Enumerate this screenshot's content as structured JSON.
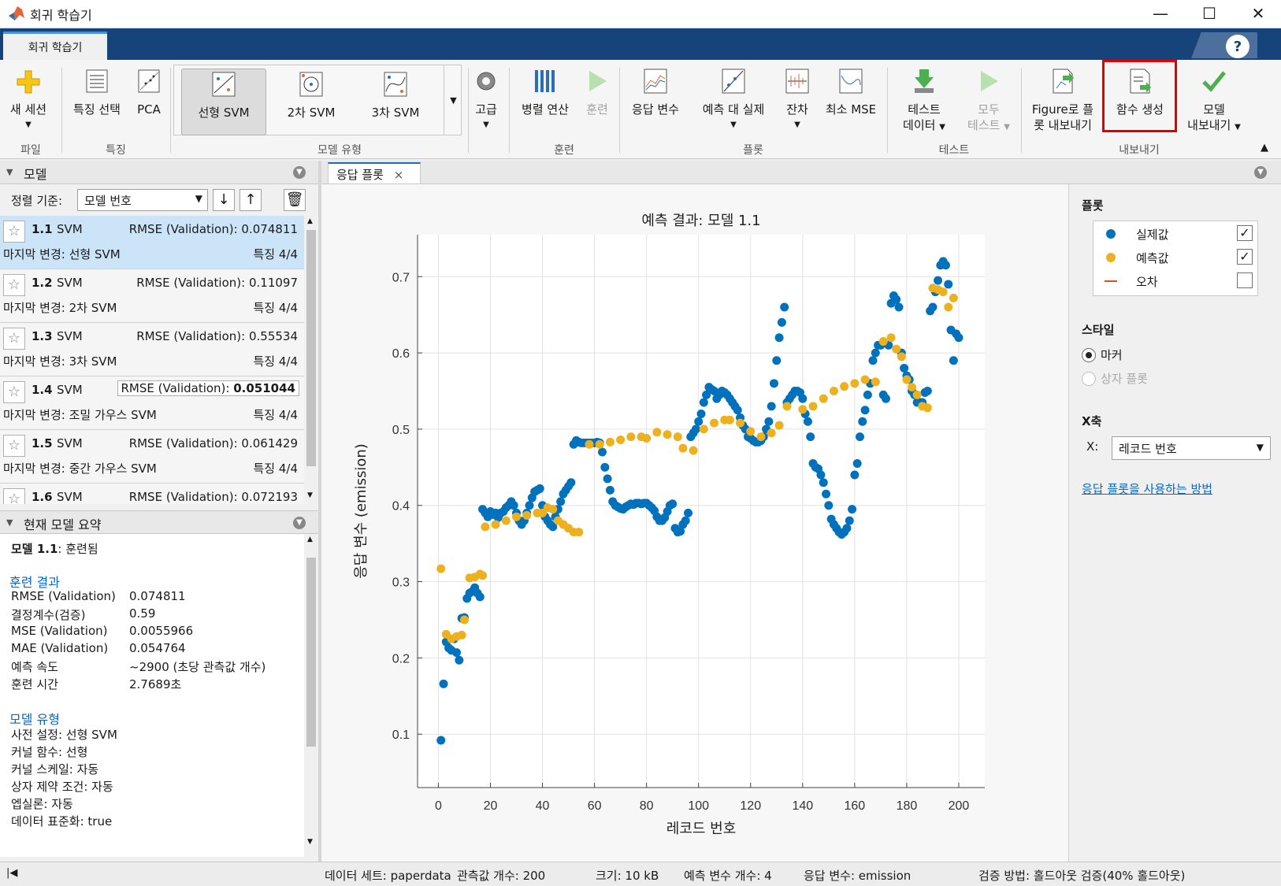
{
  "window": {
    "title": "회귀 학습기"
  },
  "tabs": {
    "main": "회귀 학습기",
    "help": "?"
  },
  "ribbon": {
    "new_session": "새 세션",
    "feature_select": "특징 선택",
    "pca": "PCA",
    "gallery": [
      "선형 SVM",
      "2차 SVM",
      "3차 SVM"
    ],
    "advanced": "고급",
    "parallel": "병렬 연산",
    "train": "훈련",
    "response": "응답 변수",
    "pred_vs_actual": "예측 대 실제",
    "residuals": "잔차",
    "min_mse": "최소 MSE",
    "test_data_1": "테스트",
    "test_data_2": "데이터",
    "test_all_1": "모두",
    "test_all_2": "테스트",
    "export_fig_1": "Figure로 플",
    "export_fig_2": "롯 내보내기",
    "gen_func": "함수 생성",
    "export_model_1": "모델",
    "export_model_2": "내보내기",
    "groups": {
      "file": "파일",
      "features": "특징",
      "model_type": "모델 유형",
      "training": "훈련",
      "plots": "플롯",
      "test": "테스트",
      "export": "내보내기"
    }
  },
  "models_panel": {
    "title": "모델",
    "sort_label": "정렬 기준:",
    "sort_value": "모델 번호",
    "items": [
      {
        "id": "1.1",
        "type": "SVM",
        "rmse": "RMSE (Validation): 0.074811",
        "last": "마지막 변경: 선형 SVM",
        "feat": "특징 4/4"
      },
      {
        "id": "1.2",
        "type": "SVM",
        "rmse": "RMSE (Validation): 0.11097",
        "last": "마지막 변경: 2차 SVM",
        "feat": "특징 4/4"
      },
      {
        "id": "1.3",
        "type": "SVM",
        "rmse": "RMSE (Validation): 0.55534",
        "last": "마지막 변경: 3차 SVM",
        "feat": "특징 4/4"
      },
      {
        "id": "1.4",
        "type": "SVM",
        "rmse_label": "RMSE (Validation): ",
        "rmse_val": "0.051044",
        "last": "마지막 변경: 조밀 가우스 SVM",
        "feat": "특징 4/4"
      },
      {
        "id": "1.5",
        "type": "SVM",
        "rmse": "RMSE (Validation): 0.061429",
        "last": "마지막 변경: 중간 가우스 SVM",
        "feat": "특징 4/4"
      },
      {
        "id": "1.6",
        "type": "SVM",
        "rmse": "RMSE (Validation): 0.072193",
        "last": "",
        "feat": ""
      }
    ]
  },
  "summary": {
    "title": "현재 모델 요약",
    "model_line_bold": "모델 1.1",
    "model_line_rest": ": 훈련됨",
    "results_hdr": "훈련 결과",
    "results": [
      [
        "RMSE (Validation)",
        "0.074811"
      ],
      [
        "결정계수(검증)",
        "0.59"
      ],
      [
        "MSE (Validation)",
        "0.0055966"
      ],
      [
        "MAE (Validation)",
        "0.054764"
      ],
      [
        "예측 속도",
        "~2900 (초당 관측값 개수)"
      ],
      [
        "훈련 시간",
        "2.7689초"
      ]
    ],
    "type_hdr": "모델 유형",
    "type_lines": [
      "사전 설정: 선형 SVM",
      "커널 함수: 선형",
      "커널 스케일: 자동",
      "상자 제약 조건: 자동",
      "엡실론: 자동",
      "데이터 표준화: true"
    ]
  },
  "doc_tab": {
    "label": "응답 플롯",
    "close": "×"
  },
  "right_panel": {
    "plot_hdr": "플롯",
    "legend": [
      {
        "label": "실제값",
        "color": "#0072bd",
        "checked": "✓"
      },
      {
        "label": "예측값",
        "color": "#edb120",
        "checked": "✓"
      },
      {
        "label": "오차",
        "color": "#d95319",
        "checked": ""
      }
    ],
    "style_hdr": "스타일",
    "style_marker": "마커",
    "style_box": "상자 플롯",
    "xaxis_hdr": "X축",
    "x_label": "X:",
    "x_value": "레코드 번호",
    "help_link": "응답 플롯을 사용하는 방법"
  },
  "statusbar": {
    "dataset": "데이터 세트: paperdata",
    "nobs": "관측값 개수: 200",
    "size": "크기: 10 kB",
    "npred": "예측 변수 개수: 4",
    "response": "응답 변수: emission",
    "validation": "검증 방법: 홀드아웃 검증(40% 홀드아웃)"
  },
  "chart_data": {
    "type": "scatter",
    "title": "예측 결과: 모델 1.1",
    "xlabel": "레코드 번호",
    "ylabel": "응답 변수 (emission)",
    "xlim": [
      -8,
      210
    ],
    "ylim": [
      0.03,
      0.755
    ],
    "xticks": [
      0,
      20,
      40,
      60,
      80,
      100,
      120,
      140,
      160,
      180,
      200
    ],
    "yticks": [
      0.1,
      0.2,
      0.3,
      0.4,
      0.5,
      0.6,
      0.7
    ],
    "grid": true,
    "series": [
      {
        "name": "실제값",
        "color": "#0072bd",
        "x": [
          1,
          2,
          3,
          4,
          5,
          6,
          7,
          8,
          9,
          10,
          11,
          12,
          13,
          14,
          15,
          16,
          17,
          18,
          19,
          20,
          21,
          22,
          23,
          24,
          25,
          26,
          27,
          28,
          29,
          30,
          31,
          32,
          33,
          34,
          35,
          36,
          37,
          38,
          39,
          40,
          41,
          42,
          43,
          44,
          45,
          46,
          47,
          48,
          49,
          50,
          51,
          52,
          53,
          54,
          55,
          56,
          57,
          58,
          59,
          60,
          61,
          62,
          63,
          64,
          65,
          66,
          67,
          68,
          69,
          70,
          71,
          72,
          73,
          74,
          75,
          76,
          77,
          78,
          79,
          80,
          81,
          82,
          83,
          84,
          85,
          86,
          87,
          88,
          89,
          90,
          91,
          92,
          93,
          94,
          95,
          96,
          97,
          98,
          99,
          100,
          101,
          102,
          103,
          104,
          105,
          106,
          107,
          108,
          109,
          110,
          111,
          112,
          113,
          114,
          115,
          116,
          117,
          118,
          119,
          120,
          121,
          122,
          123,
          124,
          125,
          126,
          127,
          128,
          129,
          130,
          131,
          132,
          133,
          134,
          135,
          136,
          137,
          138,
          139,
          140,
          141,
          142,
          143,
          144,
          145,
          146,
          147,
          148,
          149,
          150,
          151,
          152,
          153,
          154,
          155,
          156,
          157,
          158,
          159,
          160,
          161,
          162,
          163,
          164,
          165,
          166,
          167,
          168,
          169,
          170,
          171,
          172,
          173,
          174,
          175,
          176,
          177,
          178,
          179,
          180,
          181,
          182,
          183,
          184,
          185,
          186,
          187,
          188,
          189,
          190,
          191,
          192,
          193,
          194,
          195,
          196,
          197,
          198,
          199,
          200
        ],
        "y": [
          0.092,
          0.166,
          0.221,
          0.213,
          0.21,
          0.225,
          0.207,
          0.197,
          0.252,
          0.253,
          0.278,
          0.285,
          0.287,
          0.292,
          0.285,
          0.28,
          0.395,
          0.39,
          0.385,
          0.392,
          0.388,
          0.39,
          0.384,
          0.39,
          0.392,
          0.397,
          0.4,
          0.405,
          0.4,
          0.39,
          0.38,
          0.375,
          0.38,
          0.39,
          0.4,
          0.41,
          0.418,
          0.42,
          0.422,
          0.4,
          0.385,
          0.38,
          0.375,
          0.372,
          0.385,
          0.395,
          0.405,
          0.415,
          0.42,
          0.425,
          0.43,
          0.48,
          0.485,
          0.483,
          0.482,
          0.482,
          0.482,
          0.482,
          0.482,
          0.482,
          0.483,
          0.482,
          0.47,
          0.45,
          0.435,
          0.42,
          0.405,
          0.4,
          0.398,
          0.396,
          0.395,
          0.398,
          0.4,
          0.402,
          0.401,
          0.403,
          0.403,
          0.402,
          0.403,
          0.403,
          0.4,
          0.397,
          0.393,
          0.385,
          0.38,
          0.38,
          0.384,
          0.392,
          0.4,
          0.402,
          0.37,
          0.365,
          0.366,
          0.375,
          0.38,
          0.39,
          0.49,
          0.495,
          0.5,
          0.51,
          0.52,
          0.535,
          0.545,
          0.555,
          0.552,
          0.55,
          0.54,
          0.545,
          0.55,
          0.548,
          0.545,
          0.54,
          0.535,
          0.53,
          0.525,
          0.515,
          0.505,
          0.5,
          0.49,
          0.488,
          0.485,
          0.483,
          0.483,
          0.485,
          0.49,
          0.5,
          0.51,
          0.53,
          0.56,
          0.59,
          0.62,
          0.64,
          0.66,
          0.535,
          0.54,
          0.545,
          0.55,
          0.55,
          0.548,
          0.54,
          0.52,
          0.51,
          0.49,
          0.455,
          0.45,
          0.448,
          0.44,
          0.43,
          0.415,
          0.4,
          0.382,
          0.375,
          0.37,
          0.365,
          0.362,
          0.365,
          0.37,
          0.38,
          0.395,
          0.44,
          0.455,
          0.49,
          0.51,
          0.525,
          0.545,
          0.56,
          0.59,
          0.6,
          0.61,
          0.61,
          0.545,
          0.54,
          0.61,
          0.665,
          0.675,
          0.67,
          0.66,
          0.6,
          0.58,
          0.57,
          0.565,
          0.55,
          0.545,
          0.535,
          0.535,
          0.535,
          0.548,
          0.55,
          0.655,
          0.66,
          0.68,
          0.695,
          0.715,
          0.72,
          0.715,
          0.69,
          0.63,
          0.59,
          0.625,
          0.62
        ]
      },
      {
        "name": "예측값",
        "color": "#edb120",
        "x": [
          1,
          3,
          5,
          7,
          9,
          10,
          12,
          14,
          16,
          17,
          18,
          22,
          26,
          30,
          34,
          38,
          40,
          42,
          44,
          46,
          48,
          50,
          52,
          54,
          58,
          62,
          66,
          70,
          74,
          78,
          80,
          84,
          88,
          92,
          94,
          98,
          102,
          106,
          110,
          112,
          116,
          120,
          124,
          128,
          131,
          134,
          140,
          144,
          148,
          152,
          156,
          160,
          164,
          168,
          171,
          174,
          176,
          178,
          180,
          182,
          184,
          186,
          188,
          190,
          192,
          194,
          196,
          198
        ],
        "y": [
          0.317,
          0.231,
          0.225,
          0.228,
          0.23,
          0.25,
          0.305,
          0.306,
          0.31,
          0.308,
          0.372,
          0.375,
          0.38,
          0.385,
          0.387,
          0.39,
          0.39,
          0.397,
          0.395,
          0.38,
          0.375,
          0.37,
          0.365,
          0.365,
          0.48,
          0.48,
          0.483,
          0.486,
          0.49,
          0.49,
          0.488,
          0.496,
          0.493,
          0.49,
          0.475,
          0.472,
          0.5,
          0.508,
          0.512,
          0.512,
          0.508,
          0.497,
          0.49,
          0.495,
          0.505,
          0.53,
          0.526,
          0.53,
          0.54,
          0.55,
          0.556,
          0.56,
          0.565,
          0.562,
          0.615,
          0.62,
          0.605,
          0.595,
          0.565,
          0.555,
          0.545,
          0.53,
          0.528,
          0.685,
          0.683,
          0.68,
          0.66,
          0.672
        ]
      }
    ]
  }
}
